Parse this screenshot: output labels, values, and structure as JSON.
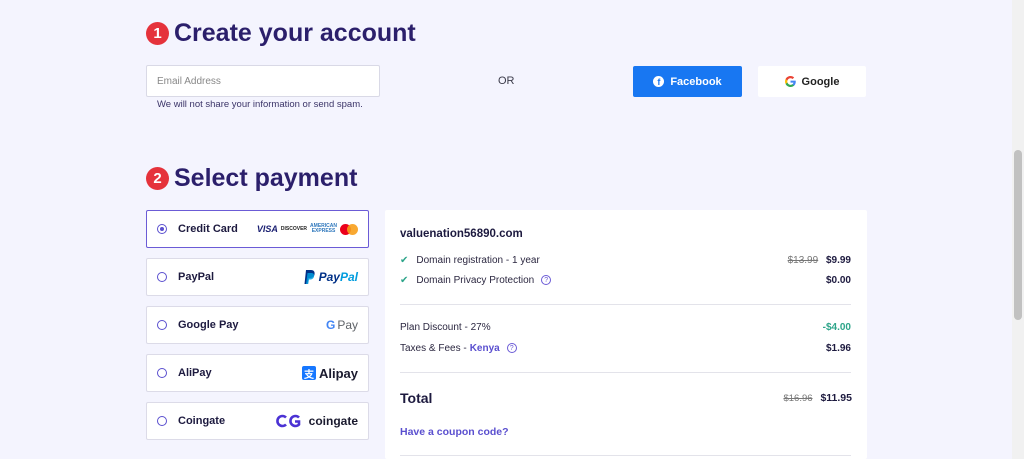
{
  "account": {
    "step_number": "1",
    "title": "Create your account",
    "email_placeholder": "Email Address",
    "email_hint": "We will not share your information or send spam.",
    "or_label": "OR",
    "facebook_label": "Facebook",
    "google_label": "Google"
  },
  "payment": {
    "step_number": "2",
    "title": "Select payment",
    "options": [
      {
        "label": "Credit Card",
        "selected": true
      },
      {
        "label": "PayPal",
        "selected": false
      },
      {
        "label": "Google Pay",
        "selected": false
      },
      {
        "label": "AliPay",
        "selected": false
      },
      {
        "label": "Coingate",
        "selected": false
      }
    ],
    "logos": {
      "visa": "VISA",
      "discover": "DISCOVER",
      "amex_line1": "AMERICAN",
      "amex_line2": "EXPRESS",
      "paypal_1": "Pay",
      "paypal_2": "Pal",
      "gpay_g": "G",
      "gpay_text": "Pay",
      "alipay_icon": "支",
      "alipay_text": "Alipay",
      "coingate_text": "coingate"
    }
  },
  "summary": {
    "domain": "valuenation56890.com",
    "items": [
      {
        "label": "Domain registration - 1 year",
        "old_price": "$13.99",
        "price": "$9.99"
      },
      {
        "label": "Domain Privacy Protection",
        "price": "$0.00"
      }
    ],
    "discount_label": "Plan Discount - 27%",
    "discount_value": "-$4.00",
    "taxes_label": "Taxes & Fees -",
    "taxes_country": "Kenya",
    "taxes_value": "$1.96",
    "total_label": "Total",
    "total_old": "$16.96",
    "total_value": "$11.95",
    "coupon_label": "Have a coupon code?"
  },
  "colors": {
    "accent": "#5a4fcf",
    "facebook": "#1877f2",
    "step_badge": "#e5323b",
    "discount": "#2ea58a"
  }
}
